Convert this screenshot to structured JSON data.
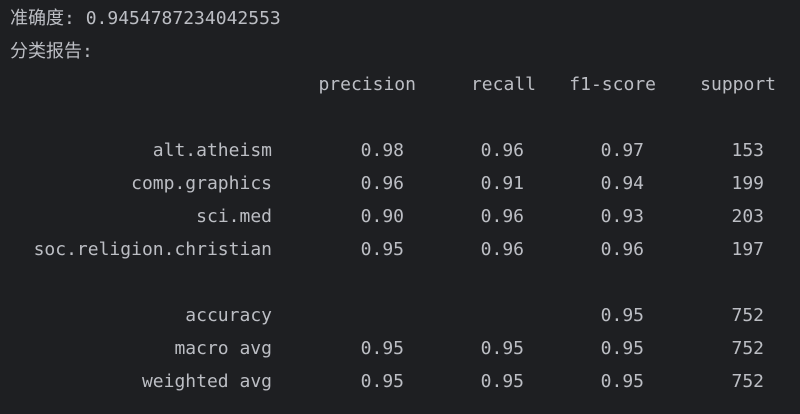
{
  "accuracy_line": {
    "label": "准确度:",
    "value": "0.9454787234042553"
  },
  "report_title": "分类报告:",
  "headers": [
    "precision",
    "recall",
    "f1-score",
    "support"
  ],
  "rows": [
    {
      "label": "alt.atheism",
      "precision": "0.98",
      "recall": "0.96",
      "f1": "0.97",
      "support": "153"
    },
    {
      "label": "comp.graphics",
      "precision": "0.96",
      "recall": "0.91",
      "f1": "0.94",
      "support": "199"
    },
    {
      "label": "sci.med",
      "precision": "0.90",
      "recall": "0.96",
      "f1": "0.93",
      "support": "203"
    },
    {
      "label": "soc.religion.christian",
      "precision": "0.95",
      "recall": "0.96",
      "f1": "0.96",
      "support": "197"
    }
  ],
  "summary": [
    {
      "label": "accuracy",
      "precision": "",
      "recall": "",
      "f1": "0.95",
      "support": "752"
    },
    {
      "label": "macro avg",
      "precision": "0.95",
      "recall": "0.95",
      "f1": "0.95",
      "support": "752"
    },
    {
      "label": "weighted avg",
      "precision": "0.95",
      "recall": "0.95",
      "f1": "0.95",
      "support": "752"
    }
  ]
}
